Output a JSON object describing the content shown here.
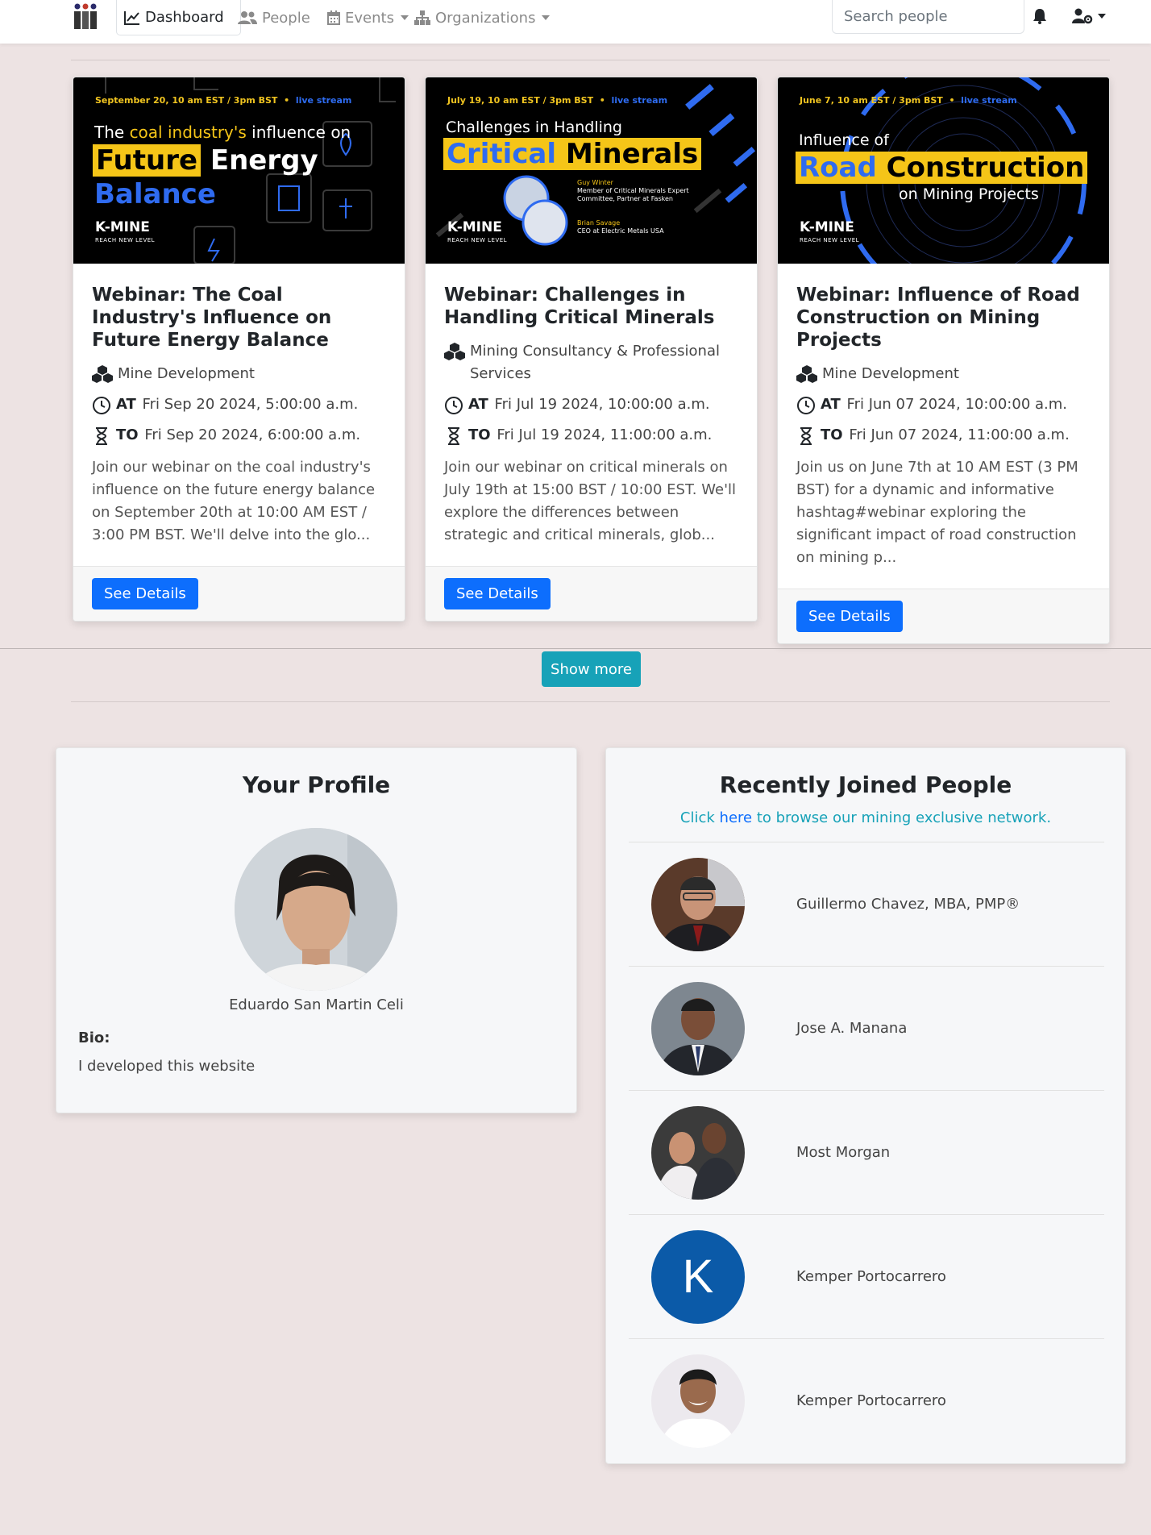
{
  "nav": {
    "dashboard": "Dashboard",
    "people": "People",
    "events": "Events",
    "organizations": "Organizations",
    "search_placeholder": "Search people"
  },
  "events": [
    {
      "title": "Webinar: The Coal Industry's Influence on Future Energy Balance",
      "category": "Mine Development",
      "at_label": "AT",
      "at": "Fri Sep 20 2024, 5:00:00 a.m.",
      "to_label": "TO",
      "to": "Fri Sep 20 2024, 6:00:00 a.m.",
      "description": "Join our webinar on the coal industry's influence on the future energy balance on September 20th at 10:00 AM EST / 3:00 PM BST. We'll delve into the glo...",
      "button": "See Details",
      "banner": {
        "date": "September 20, 10 am EST / 3pm BST",
        "live": "live stream",
        "line1a": "The ",
        "line1b": "coal industry's",
        "line1c": " influence on",
        "word1": "Future",
        "word2": "Energy",
        "word3": "Balance",
        "logo": "K-MINE",
        "logo_sub": "REACH NEW LEVEL"
      }
    },
    {
      "title": "Webinar: Challenges in Handling Critical Minerals",
      "category": "Mining Consultancy & Professional Services",
      "at_label": "AT",
      "at": "Fri Jul 19 2024, 10:00:00 a.m.",
      "to_label": "TO",
      "to": "Fri Jul 19 2024, 11:00:00 a.m.",
      "description": "Join our webinar on critical minerals on July 19th at 15:00 BST / 10:00 EST. We'll explore the differences between strategic and critical minerals, glob...",
      "button": "See Details",
      "banner": {
        "date": "July 19, 10 am EST / 3pm BST",
        "live": "live stream",
        "line1": "Challenges in Handling",
        "word1": "Critical",
        "word2": "Minerals",
        "speaker1": "Guy Winter",
        "speaker1_role": "Member of Critical Minerals Expert Committee, Partner at Fasken",
        "speaker2": "Brian Savage",
        "speaker2_role": "CEO at Electric Metals USA",
        "logo": "K-MINE",
        "logo_sub": "REACH NEW LEVEL"
      }
    },
    {
      "title": "Webinar: Influence of Road Construction on Mining Projects",
      "category": "Mine Development",
      "at_label": "AT",
      "at": "Fri Jun 07 2024, 10:00:00 a.m.",
      "to_label": "TO",
      "to": "Fri Jun 07 2024, 11:00:00 a.m.",
      "description": "Join us on June 7th at 10 AM EST (3 PM BST) for a dynamic and informative hashtag#webinar exploring the significant impact of road construction on mining p...",
      "button": "See Details",
      "banner": {
        "date": "June 7, 10 am EST / 3pm BST",
        "live": "live stream",
        "line1": "Influence of",
        "word1": "Road",
        "word2": "Construction",
        "line3": "on Mining Projects",
        "logo": "K-MINE",
        "logo_sub": "REACH NEW LEVEL"
      }
    }
  ],
  "show_more": "Show more",
  "profile": {
    "title": "Your Profile",
    "name": "Eduardo San Martin Celi",
    "bio_label": "Bio:",
    "bio": "I developed this website"
  },
  "recent": {
    "title": "Recently Joined People",
    "sub_before": "Click ",
    "sub_link": "here",
    "sub_after": " to browse our mining exclusive network.",
    "people": [
      {
        "name": "Guillermo Chavez, MBA, PMP®"
      },
      {
        "name": "Jose A. Manana"
      },
      {
        "name": "Most Morgan"
      },
      {
        "name": "Kemper Portocarrero",
        "initial": "K"
      },
      {
        "name": "Kemper Portocarrero"
      }
    ]
  },
  "colors": {
    "primary": "#0d6efd",
    "info": "#17a2b8",
    "background": "#ede3e3",
    "banner_yellow": "#f5c518",
    "banner_blue": "#2f6bf0"
  }
}
